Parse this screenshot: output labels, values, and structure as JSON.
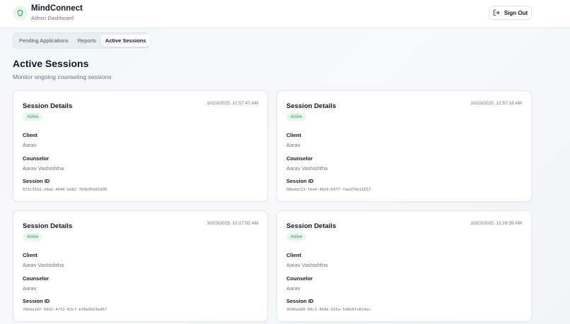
{
  "header": {
    "title": "MindConnect",
    "subtitle": "Admin Dashboard",
    "signout_label": "Sign Out"
  },
  "tabs": [
    {
      "label": "Pending Applications",
      "active": false
    },
    {
      "label": "Reports",
      "active": false
    },
    {
      "label": "Active Sessions",
      "active": true
    }
  ],
  "page": {
    "title": "Active Sessions",
    "subtitle": "Monitor ongoing counseling sessions"
  },
  "labels": {
    "client": "Client",
    "counselor": "Counselor",
    "session_id": "Session ID"
  },
  "sessions": [
    {
      "title": "Session Details",
      "status": "Active",
      "time": "10/23/2025, 12:57:47 AM",
      "client": "Aarav",
      "counselor": "Aarav Vashishtha",
      "session_id": "073c33d2-d4ab-4040-be82-7b9b95de5d90"
    },
    {
      "title": "Session Details",
      "status": "Active",
      "time": "10/23/2025, 12:57:18 AM",
      "client": "Aarav",
      "counselor": "Aarav Vashishtha",
      "session_id": "08bddc53-7bd4-4820-b077-faed7de11657"
    },
    {
      "title": "Session Details",
      "status": "Active",
      "time": "10/23/2025, 12:17:02 AM",
      "client": "Aarav Vashishtha",
      "counselor": "Aarav",
      "session_id": "70bda10f-99d2-4ff2-83cf-bf8e0d24a467"
    },
    {
      "title": "Session Details",
      "status": "Active",
      "time": "10/23/2025, 12:16:39 AM",
      "client": "Aarav Vashishtha",
      "counselor": "Aarav",
      "session_id": "3006eb88-88c1-404d-925a-5d8b8fe814ec"
    }
  ],
  "colors": {
    "accent_green": "#22a04b",
    "badge_bg": "#e6f7ec"
  },
  "icons": {
    "logo": "shield-icon",
    "signout": "log-out-icon"
  }
}
